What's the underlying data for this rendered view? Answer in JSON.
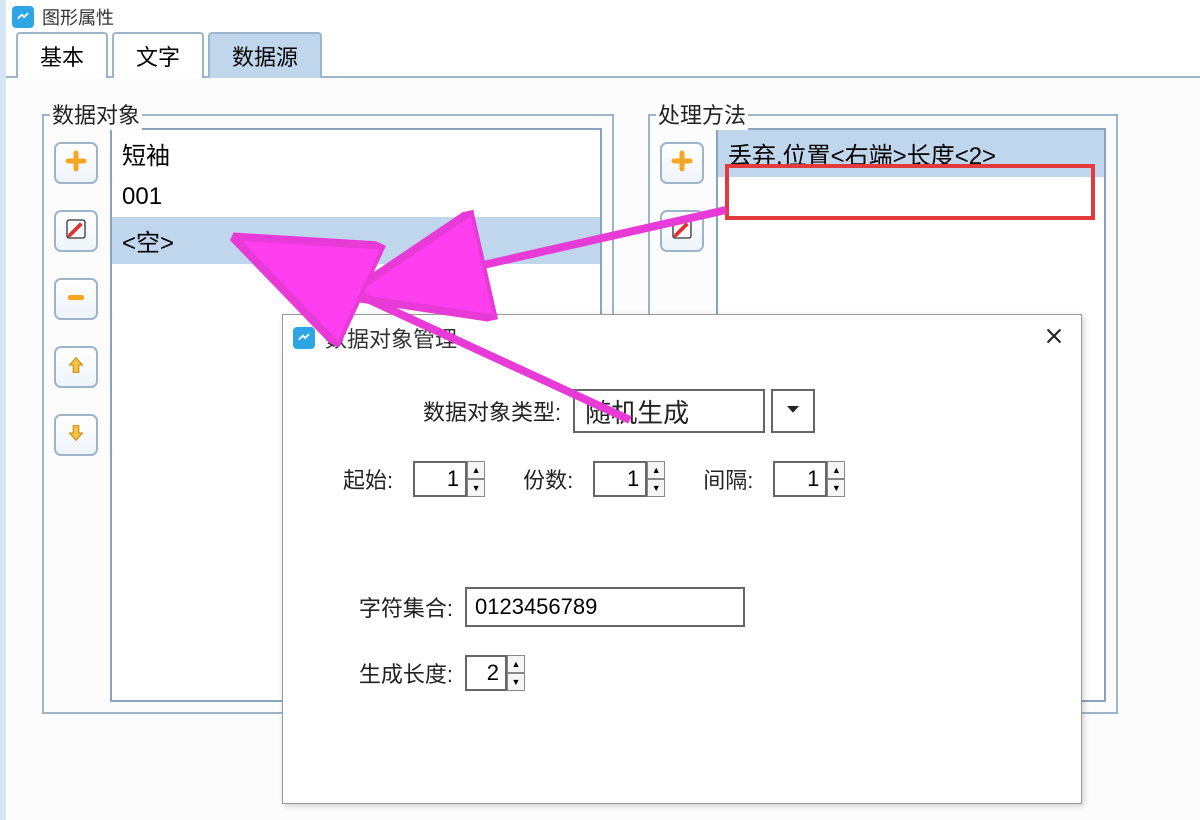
{
  "window": {
    "title": "图形属性"
  },
  "tabs": {
    "basic": "基本",
    "text": "文字",
    "datasource": "数据源"
  },
  "left_group": {
    "label": "数据对象",
    "items": [
      "短袖",
      "001",
      "<空>"
    ],
    "selected_index": 2
  },
  "right_group": {
    "label": "处理方法",
    "items": [
      "丢弃,位置<右端>长度<2>"
    ],
    "selected_index": 0
  },
  "dialog": {
    "title": "数据对象管理",
    "type_label": "数据对象类型:",
    "type_value": "随机生成",
    "start_label": "起始:",
    "start_value": "1",
    "copies_label": "份数:",
    "copies_value": "1",
    "interval_label": "间隔:",
    "interval_value": "1",
    "charset_label": "字符集合:",
    "charset_value": "0123456789",
    "genlen_label": "生成长度:",
    "genlen_value": "2"
  },
  "colors": {
    "highlight": "#e23b3b",
    "arrow": "#e73ad6",
    "arrow_fill": "#ff3ef0"
  }
}
